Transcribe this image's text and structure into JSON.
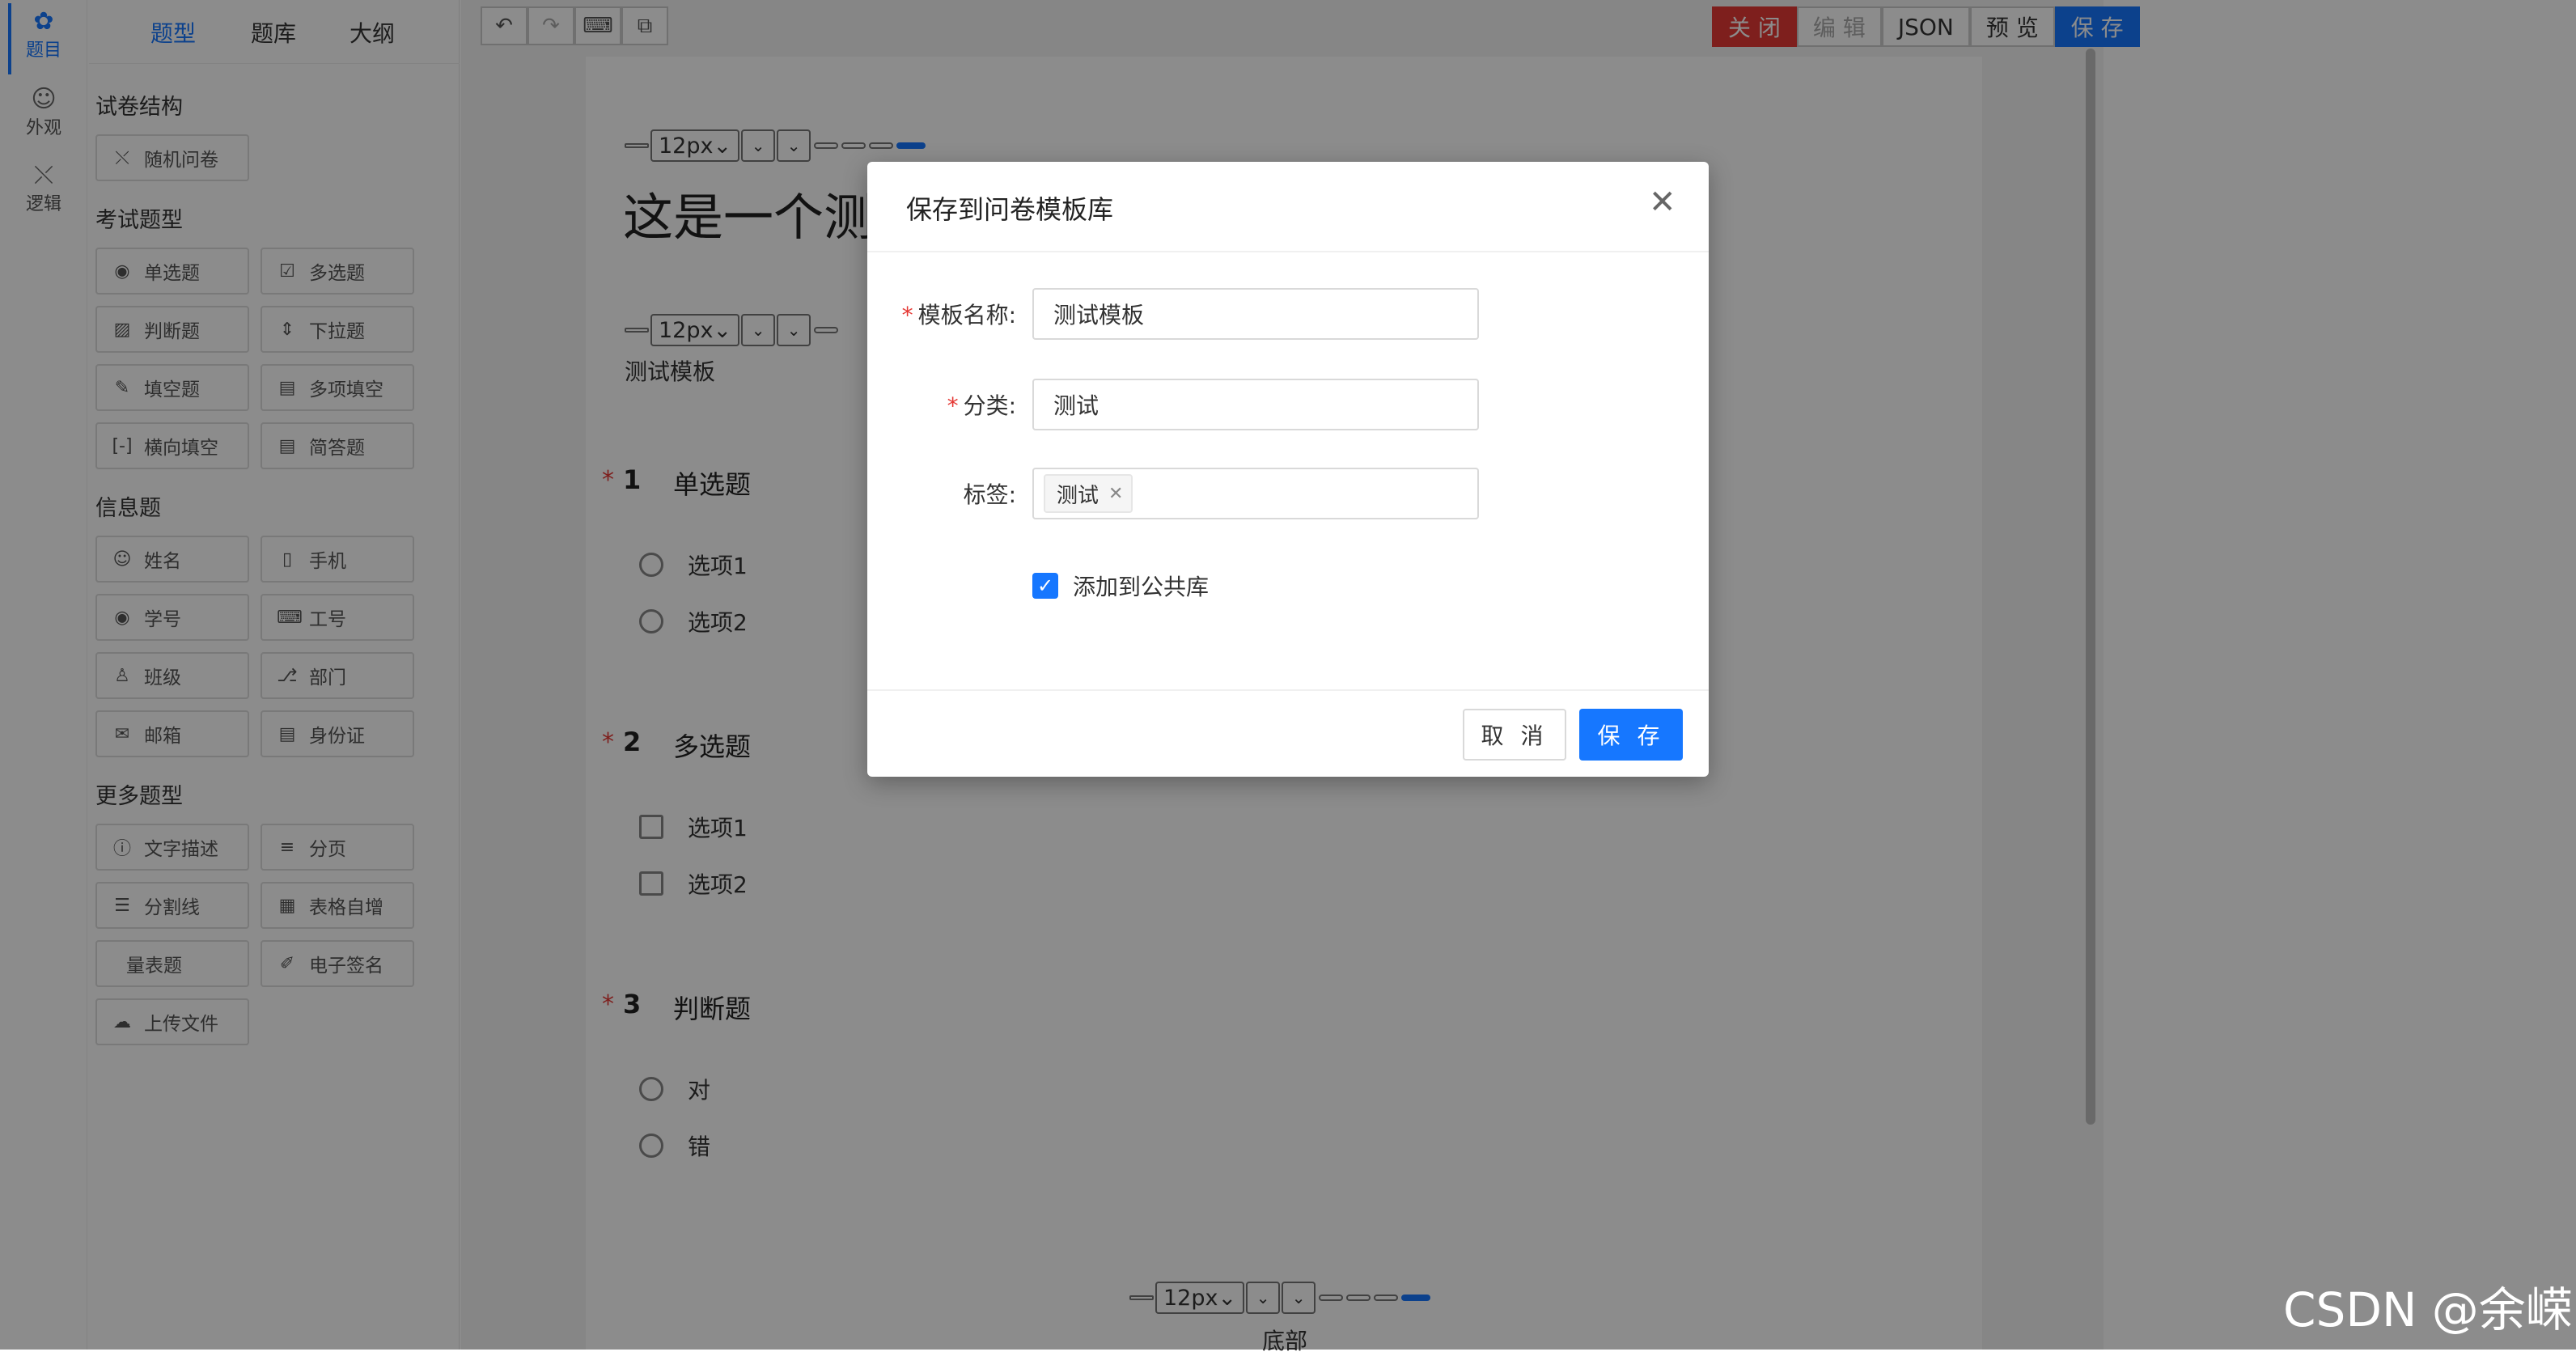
{
  "rail": {
    "items": [
      {
        "label": "题目",
        "icon": "questions-icon"
      },
      {
        "label": "外观",
        "icon": "palette-icon"
      },
      {
        "label": "逻辑",
        "icon": "shuffle-icon"
      }
    ]
  },
  "palette": {
    "tabs": [
      "题型",
      "题库",
      "大纲"
    ],
    "sections": {
      "structure": "试卷结构",
      "exam": "考试题型",
      "info": "信息题",
      "more": "更多题型"
    },
    "buttons": {
      "random_paper": "随机问卷",
      "single_choice": "单选题",
      "multi_choice": "多选题",
      "true_false": "判断题",
      "dropdown": "下拉题",
      "fill_blank": "填空题",
      "multi_fill": "多项填空",
      "horizontal_fill": "横向填空",
      "short_answer": "简答题",
      "name": "姓名",
      "phone": "手机",
      "student_no": "学号",
      "employee_no": "工号",
      "class": "班级",
      "department": "部门",
      "email": "邮箱",
      "id_card": "身份证",
      "text_desc": "文字描述",
      "pagination": "分页",
      "divider": "分割线",
      "table_grow": "表格自增",
      "scale": "量表题",
      "signature": "电子签名",
      "upload": "上传文件"
    }
  },
  "toolbar": {
    "close": "关 闭",
    "edit": "编 辑",
    "json": "JSON",
    "preview": "预 览",
    "save": "保 存"
  },
  "canvas": {
    "font_size": "12px",
    "title": "这是一个测",
    "subtitle": "测试模板",
    "questions": [
      {
        "number": "1",
        "title": "单选题",
        "type": "radio",
        "options": [
          "选项1",
          "选项2"
        ]
      },
      {
        "number": "2",
        "title": "多选题",
        "type": "checkbox",
        "options": [
          "选项1",
          "选项2"
        ]
      },
      {
        "number": "3",
        "title": "判断题",
        "type": "radio",
        "options": [
          "对",
          "错"
        ]
      }
    ],
    "footer": "底部",
    "required_mark": "*"
  },
  "modal": {
    "title": "保存到问卷模板库",
    "fields": {
      "name_label": "模板名称:",
      "name_value": "测试模板",
      "category_label": "分类:",
      "category_value": "测试",
      "tags_label": "标签:",
      "tag_value": "测试"
    },
    "checkbox_label": "添加到公共库",
    "checkbox_checked": true,
    "cancel": "取 消",
    "save": "保 存"
  },
  "watermark": "CSDN @余嵘",
  "colors": {
    "accent": "#1677ff",
    "danger": "#e53935",
    "mask": "rgba(0,0,0,0.45)"
  }
}
